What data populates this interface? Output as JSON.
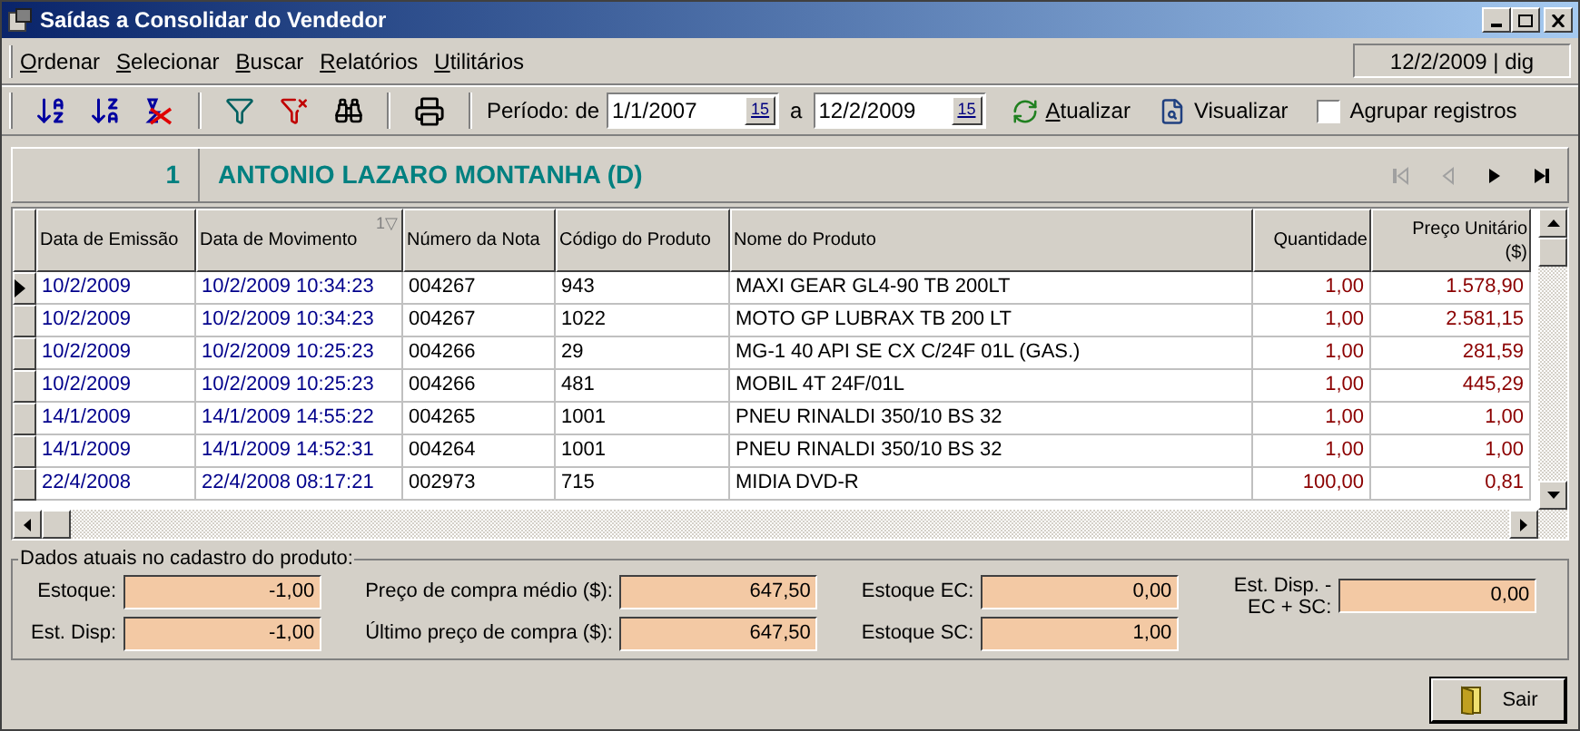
{
  "window": {
    "title": "Saídas a Consolidar do Vendedor"
  },
  "menu": [
    "Ordenar",
    "Selecionar",
    "Buscar",
    "Relatórios",
    "Utilitários"
  ],
  "status": "12/2/2009 | dig",
  "toolbar": {
    "period_label": "Período: de",
    "date_from": "1/1/2007",
    "separator": "a",
    "date_to": "12/2/2009",
    "from_calendar_label": "15",
    "to_calendar_label": "15",
    "refresh": "Atualizar",
    "preview": "Visualizar",
    "group": {
      "label": "Agrupar registros",
      "checked": false
    }
  },
  "vendor": {
    "number": "1",
    "name": "ANTONIO LAZARO MONTANHA (D)"
  },
  "nav": [
    {
      "kind": "first",
      "disabled": true
    },
    {
      "kind": "prev",
      "disabled": true
    },
    {
      "kind": "next",
      "disabled": false
    },
    {
      "kind": "last",
      "disabled": false
    }
  ],
  "table": {
    "columns": [
      {
        "label": "Data de Emissão"
      },
      {
        "label": "Data de Movimento",
        "sort": "1▽"
      },
      {
        "label": "Número da Nota"
      },
      {
        "label": "Código do Produto"
      },
      {
        "label": "Nome do Produto"
      },
      {
        "label": "Quantidade"
      },
      {
        "label": "Preço Unitário ($)"
      }
    ],
    "rows": [
      {
        "selected": true,
        "cells": [
          "10/2/2009",
          "10/2/2009 10:34:23",
          "004267",
          "943",
          "MAXI GEAR GL4-90 TB 200LT",
          "1,00",
          "1.578,90"
        ]
      },
      {
        "selected": false,
        "cells": [
          "10/2/2009",
          "10/2/2009 10:34:23",
          "004267",
          "1022",
          "MOTO GP LUBRAX TB 200 LT",
          "1,00",
          "2.581,15"
        ]
      },
      {
        "selected": false,
        "cells": [
          "10/2/2009",
          "10/2/2009 10:25:23",
          "004266",
          "29",
          "MG-1 40 API SE CX C/24F 01L (GAS.)",
          "1,00",
          "281,59"
        ]
      },
      {
        "selected": false,
        "cells": [
          "10/2/2009",
          "10/2/2009 10:25:23",
          "004266",
          "481",
          "MOBIL 4T 24F/01L",
          "1,00",
          "445,29"
        ]
      },
      {
        "selected": false,
        "cells": [
          "14/1/2009",
          "14/1/2009 14:55:22",
          "004265",
          "1001",
          "PNEU RINALDI 350/10 BS 32",
          "1,00",
          "1,00"
        ]
      },
      {
        "selected": false,
        "cells": [
          "14/1/2009",
          "14/1/2009 14:52:31",
          "004264",
          "1001",
          "PNEU RINALDI 350/10 BS 32",
          "1,00",
          "1,00"
        ]
      },
      {
        "selected": false,
        "cells": [
          "22/4/2008",
          "22/4/2008 08:17:21",
          "002973",
          "715",
          "MIDIA DVD-R",
          "100,00",
          "0,81"
        ]
      }
    ]
  },
  "details": {
    "title": "Dados atuais no cadastro do produto:",
    "columns": [
      [
        {
          "label": "Estoque:",
          "value": "-1,00"
        },
        {
          "label": "Est. Disp:",
          "value": "-1,00"
        }
      ],
      [
        {
          "label": "Preço de compra médio ($):",
          "value": "647,50"
        },
        {
          "label": "Último preço de compra ($):",
          "value": "647,50"
        }
      ],
      [
        {
          "label": "Estoque EC:",
          "value": "0,00"
        },
        {
          "label": "Estoque SC:",
          "value": "1,00"
        }
      ],
      [
        {
          "label": "Est. Disp. - EC + SC:",
          "value": "0,00"
        }
      ]
    ]
  },
  "exit_button": "Sair"
}
